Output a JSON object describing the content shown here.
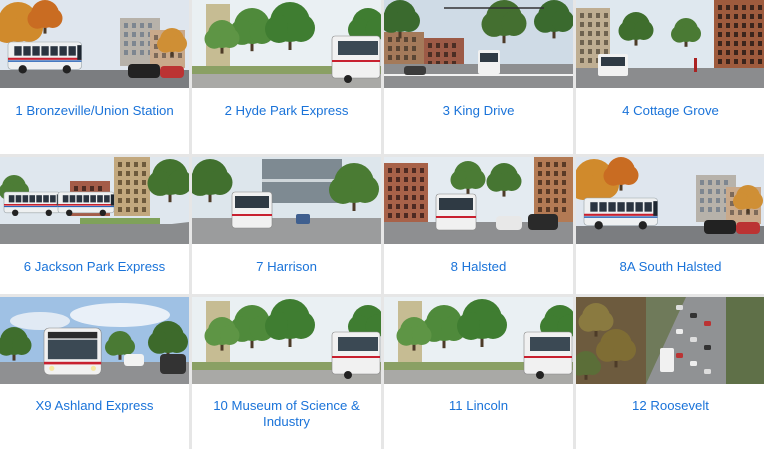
{
  "theme": {
    "link_color": "#1a73d9",
    "divider_color": "#e6e6e6"
  },
  "routes": [
    {
      "number": "1",
      "name": "1 Bronzeville/Union Station",
      "photo": "bus-on-tree-lined-street",
      "scene": "autumn"
    },
    {
      "number": "2",
      "name": "2 Hyde Park Express",
      "photo": "bus-beside-park",
      "scene": "park"
    },
    {
      "number": "3",
      "name": "3 King Drive",
      "photo": "bus-at-intersection",
      "scene": "intersection"
    },
    {
      "number": "4",
      "name": "4 Cottage Grove",
      "photo": "bus-on-commercial-street",
      "scene": "storefronts"
    },
    {
      "number": "6",
      "name": "6 Jackson Park Express",
      "photo": "articulated-bus-on-avenue",
      "scene": "articulated"
    },
    {
      "number": "7",
      "name": "7 Harrison",
      "photo": "bus-near-station",
      "scene": "station"
    },
    {
      "number": "8",
      "name": "8 Halsted",
      "photo": "bus-on-busy-street",
      "scene": "halsted"
    },
    {
      "number": "8A",
      "name": "8A South Halsted",
      "photo": "bus-on-tree-lined-street",
      "scene": "autumn"
    },
    {
      "number": "X9",
      "name": "X9 Ashland Express",
      "photo": "bus-front-view",
      "scene": "front"
    },
    {
      "number": "10",
      "name": "10 Museum of Science & Industry",
      "photo": "bus-beside-park",
      "scene": "park"
    },
    {
      "number": "11",
      "name": "11 Lincoln",
      "photo": "bus-beside-park",
      "scene": "park"
    },
    {
      "number": "12",
      "name": "12 Roosevelt",
      "photo": "aerial-view-of-roadway",
      "scene": "aerial"
    }
  ]
}
